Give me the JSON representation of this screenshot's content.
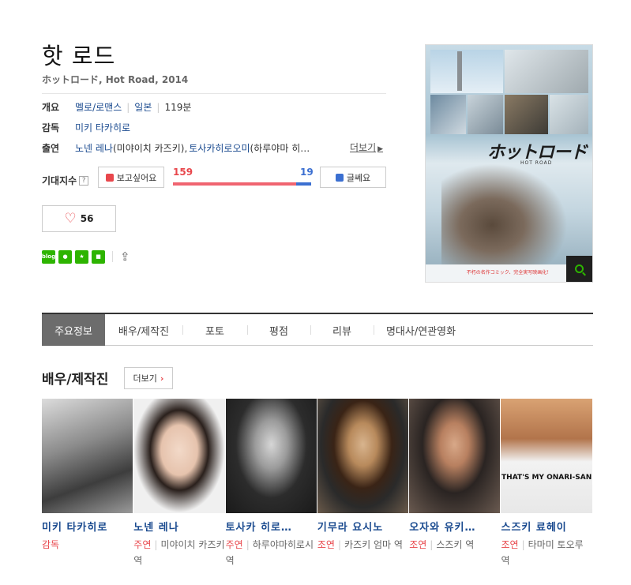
{
  "movie": {
    "title": "핫 로드",
    "subtitle": "ホットロード, Hot Road, 2014"
  },
  "info": {
    "overview_label": "개요",
    "genre": "멜로/로맨스",
    "country": "일본",
    "runtime": "119분",
    "director_label": "감독",
    "director": "미키 타카히로",
    "cast_label": "출연",
    "cast_1": "노넨 레나",
    "cast_1_role": "(미야이치 카즈키),",
    "cast_2": "토사카히로오미",
    "cast_2_role": "(하루야마 히…",
    "more": "더보기"
  },
  "expect": {
    "label": "기대지수",
    "help_icon": "?",
    "want_label": "보고싶어요",
    "want_count": "159",
    "meh_label": "글쎄요",
    "meh_count": "19",
    "want_ratio": 0.893
  },
  "likes": {
    "count": "56"
  },
  "share": {
    "blog": "blog",
    "icons": [
      "naver-blog-icon",
      "band-icon",
      "star-icon",
      "line-icon",
      "share-icon"
    ]
  },
  "poster": {
    "title": "ホットロード",
    "sub": "HOT ROAD",
    "tagline": "不朽の名作コミック、完全実写映画化！"
  },
  "tabs": [
    "주요정보",
    "배우/제작진",
    "포토",
    "평점",
    "리뷰",
    "명대사/연관영화"
  ],
  "section": {
    "title": "배우/제작진",
    "more": "더보기"
  },
  "cast": [
    {
      "name": "미키 타카히로",
      "type": "감독",
      "role": ""
    },
    {
      "name": "노넨 레나",
      "type": "주연",
      "role": "미야이치 카즈키 역"
    },
    {
      "name": "토사카 히로…",
      "type": "주연",
      "role": "하루야마히로시 역"
    },
    {
      "name": "기무라 요시노",
      "type": "조연",
      "role": "카즈키 엄마 역"
    },
    {
      "name": "오자와 유키…",
      "type": "조연",
      "role": "스즈키 역"
    },
    {
      "name": "스즈키 료헤이",
      "type": "조연",
      "role": "타마미 토오루 역"
    }
  ],
  "shirt_text": "THAT'S MY ONARI-SAN",
  "colors": {
    "accent_red": "#e8474c",
    "link_blue": "#1a4a8f",
    "naver_green": "#2db400",
    "meh_blue": "#3b6fd1"
  }
}
